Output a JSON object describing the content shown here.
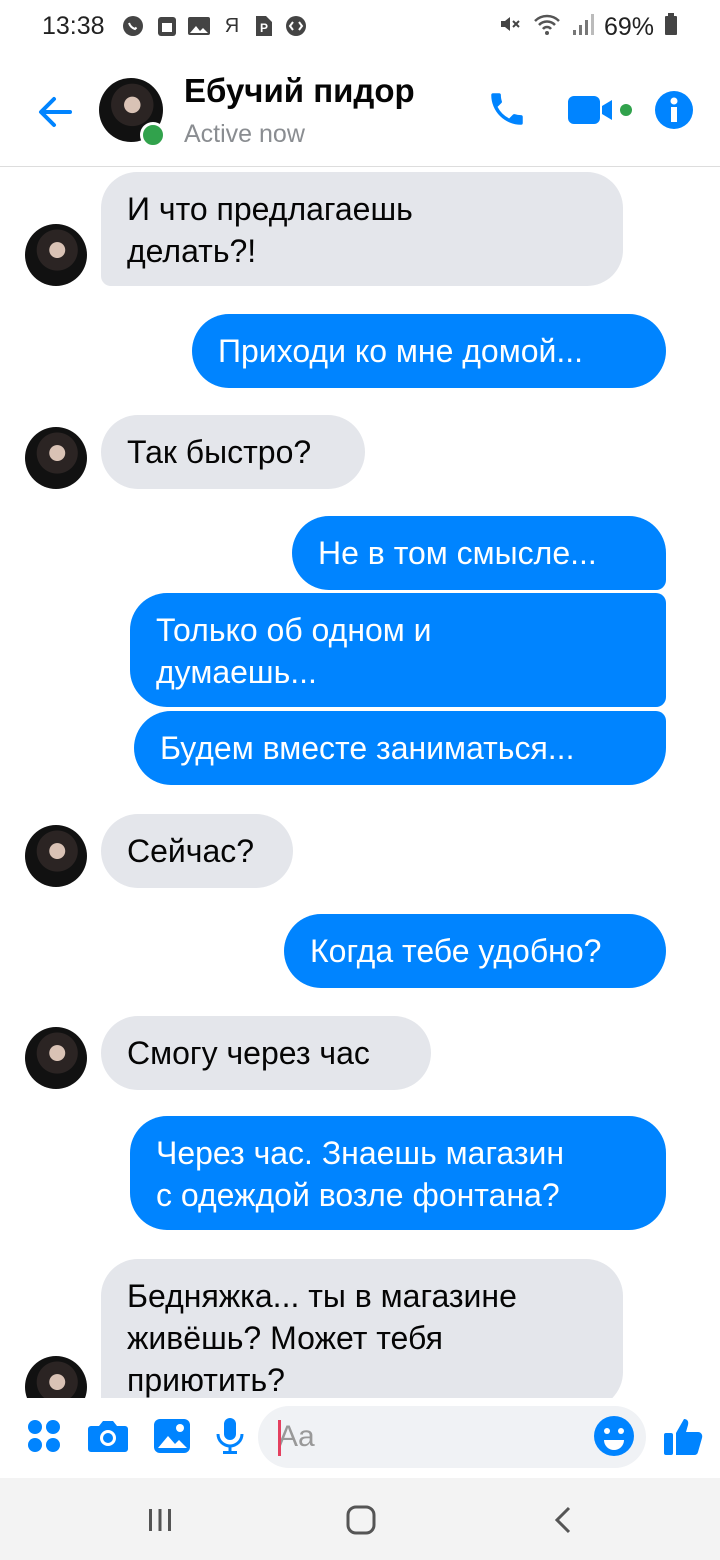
{
  "status_bar": {
    "time": "13:38",
    "letter_icon": "Я",
    "battery": "69%",
    "left_icons": [
      "whatsapp-icon",
      "calendar-icon",
      "gallery-icon",
      "ya-icon",
      "p-icon",
      "shazam-icon"
    ],
    "right_icons": [
      "mute-icon",
      "wifi-icon",
      "signal-icon",
      "battery-icon"
    ]
  },
  "header": {
    "name": "Ебучий пидор",
    "status": "Active now",
    "accent_color": "#0084ff",
    "online_color": "#31a24c"
  },
  "messages": [
    {
      "from": "them",
      "text": "И что предлагаешь\nделать?!"
    },
    {
      "from": "me",
      "text": "Приходи ко мне домой..."
    },
    {
      "from": "them",
      "text": "Так быстро?"
    },
    {
      "from": "me",
      "text": "Не в том смысле..."
    },
    {
      "from": "me",
      "text": "Только об одном и\nдумаешь..."
    },
    {
      "from": "me",
      "text": "Будем вместе заниматься..."
    },
    {
      "from": "them",
      "text": "Сейчас?"
    },
    {
      "from": "me",
      "text": "Когда тебе удобно?"
    },
    {
      "from": "them",
      "text": "Смогу через час"
    },
    {
      "from": "me",
      "text": "Через час. Знаешь магазин\nс одеждой возле фонтана?"
    },
    {
      "from": "them",
      "text": "Бедняжка... ты в магазине\nживёшь? Может тебя\nприютить?"
    }
  ],
  "composer": {
    "placeholder": "Aa"
  },
  "colors": {
    "outgoing_bubble": "#0084ff",
    "incoming_bubble": "#e4e6eb"
  }
}
